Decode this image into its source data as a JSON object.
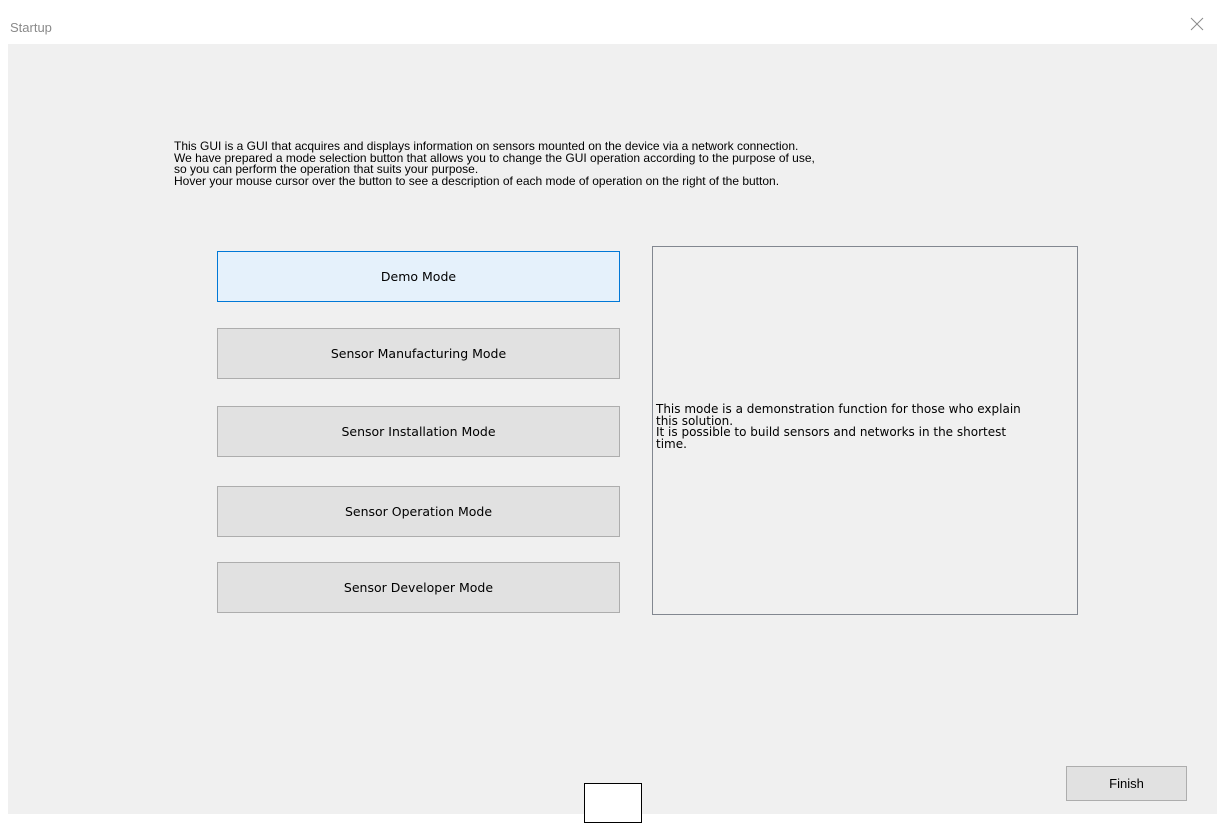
{
  "window": {
    "title": "Startup",
    "close_icon": "close-icon"
  },
  "intro": {
    "lines": [
      "This GUI is a GUI that acquires and displays information on sensors mounted on the device via a network connection.",
      "We have prepared a mode selection button that allows you to change the GUI operation according to the purpose of use,",
      "so you can perform the operation that suits your purpose.",
      "Hover your mouse cursor over the button to see a description of each mode of operation on the right of the button."
    ]
  },
  "modes": [
    {
      "label": "Demo Mode",
      "state": "hovered"
    },
    {
      "label": "Sensor Manufacturing Mode",
      "state": "normal"
    },
    {
      "label": "Sensor Installation Mode",
      "state": "normal"
    },
    {
      "label": "Sensor Operation Mode",
      "state": "normal"
    },
    {
      "label": "Sensor Developer Mode",
      "state": "normal"
    }
  ],
  "description": {
    "text": "This mode is a demonstration function for those who explain\nthis solution.\nIt is possible to build sensors and networks in the shortest\ntime."
  },
  "footer": {
    "finish_label": "Finish"
  },
  "colors": {
    "window_bg": "#f0f0f0",
    "button_bg": "#e1e1e1",
    "button_border": "#adadad",
    "hover_bg": "#e5f1fb",
    "hover_border": "#0078d7"
  }
}
